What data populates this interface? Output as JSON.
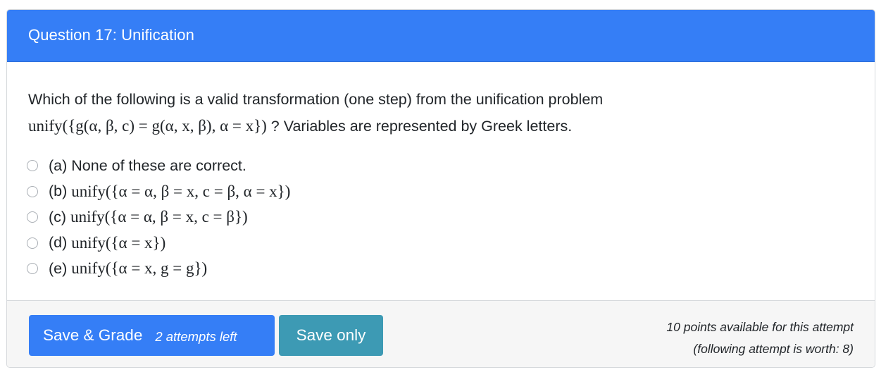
{
  "header": {
    "title": "Question 17: Unification"
  },
  "question": {
    "text_before": "Which of the following is a valid transformation (one step) from the unification problem",
    "expression": "unify({g(α, β, c) = g(α, x, β), α = x})",
    "text_after": " ? Variables are represented by Greek letters."
  },
  "options": [
    {
      "letter": "(a)",
      "text": "None of these are correct.",
      "is_math": false,
      "selected": false
    },
    {
      "letter": "(b)",
      "text": "unify({α = α, β = x, c = β, α = x})",
      "is_math": true,
      "selected": false
    },
    {
      "letter": "(c)",
      "text": "unify({α = α, β = x, c = β})",
      "is_math": true,
      "selected": false
    },
    {
      "letter": "(d)",
      "text": "unify({α = x})",
      "is_math": true,
      "selected": false
    },
    {
      "letter": "(e)",
      "text": "unify({α = x, g = g})",
      "is_math": true,
      "selected": false
    }
  ],
  "footer": {
    "save_grade_label": "Save & Grade",
    "attempts_left": "2 attempts left",
    "save_only_label": "Save only",
    "points_line1": "10 points available for this attempt",
    "points_line2": "(following attempt is worth: 8)"
  },
  "colors": {
    "header_bg": "#357ef6",
    "primary_button": "#357ef6",
    "info_button": "#3d9ab4",
    "footer_bg": "#f6f6f6"
  }
}
